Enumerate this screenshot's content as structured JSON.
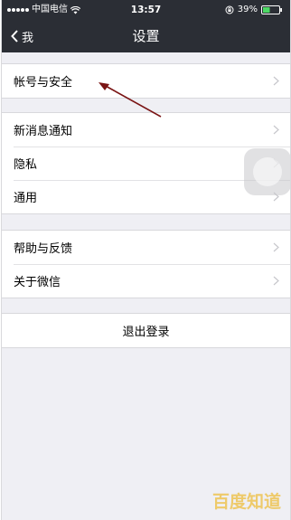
{
  "status_bar": {
    "carrier": "中国电信",
    "time": "13:57",
    "battery": "39%",
    "signal_bars": 5
  },
  "nav": {
    "back_label": "我",
    "title": "设置"
  },
  "groups": [
    {
      "items": [
        {
          "label": "帐号与安全"
        }
      ]
    },
    {
      "items": [
        {
          "label": "新消息通知"
        },
        {
          "label": "隐私"
        },
        {
          "label": "通用"
        }
      ]
    },
    {
      "items": [
        {
          "label": "帮助与反馈"
        },
        {
          "label": "关于微信"
        }
      ]
    }
  ],
  "logout_label": "退出登录",
  "watermark": "百度知道",
  "colors": {
    "topbar": "#2b2e35",
    "background": "#efeff4",
    "arrow": "#7a1414",
    "watermark": "#eebe3c"
  }
}
